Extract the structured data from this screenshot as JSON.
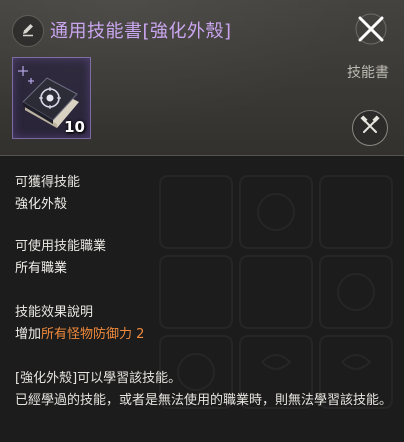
{
  "header": {
    "title": "通用技能書[強化外殼]",
    "category": "技能書",
    "item_count": "10",
    "title_color": "#c8a3f0"
  },
  "icons": {
    "edit": "pencil-icon",
    "close": "close-icon",
    "item": "skill-book-icon",
    "craft": "crossed-hammers-icon"
  },
  "sections": {
    "obtain_label": "可獲得技能",
    "obtain_value": "強化外殼",
    "class_label": "可使用技能職業",
    "class_value": "所有職業",
    "effect_label": "技能效果說明",
    "effect_prefix": "增加",
    "effect_highlight": "所有怪物防御力 2",
    "highlight_color": "#f08a3c"
  },
  "description": {
    "line1": "[強化外殼]可以學習該技能。",
    "line2": "已經學過的技能，或者是無法使用的職業時，則無法學習該技能。"
  }
}
